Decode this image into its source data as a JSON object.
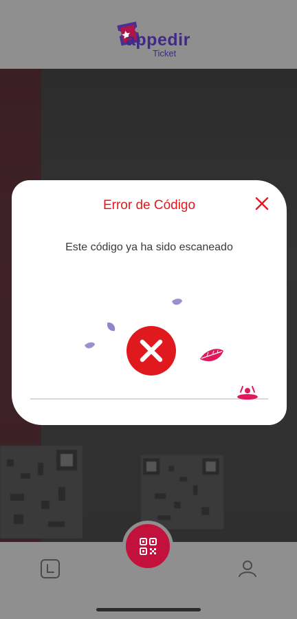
{
  "header": {
    "logo_word": "appedir",
    "logo_sub": "Ticket"
  },
  "modal": {
    "title": "Error de Código",
    "message": "Este código ya ha sido escaneado",
    "close_icon": "close-icon",
    "status_icon": "error-x-icon"
  },
  "nav": {
    "left_icon": "history-icon",
    "center_icon": "qr-scan-icon",
    "right_icon": "profile-icon"
  },
  "colors": {
    "accent_red": "#e0191e",
    "brand_crimson": "#c2113d",
    "brand_purple": "#3f2a87",
    "leaf_purple": "#8f86c9"
  }
}
